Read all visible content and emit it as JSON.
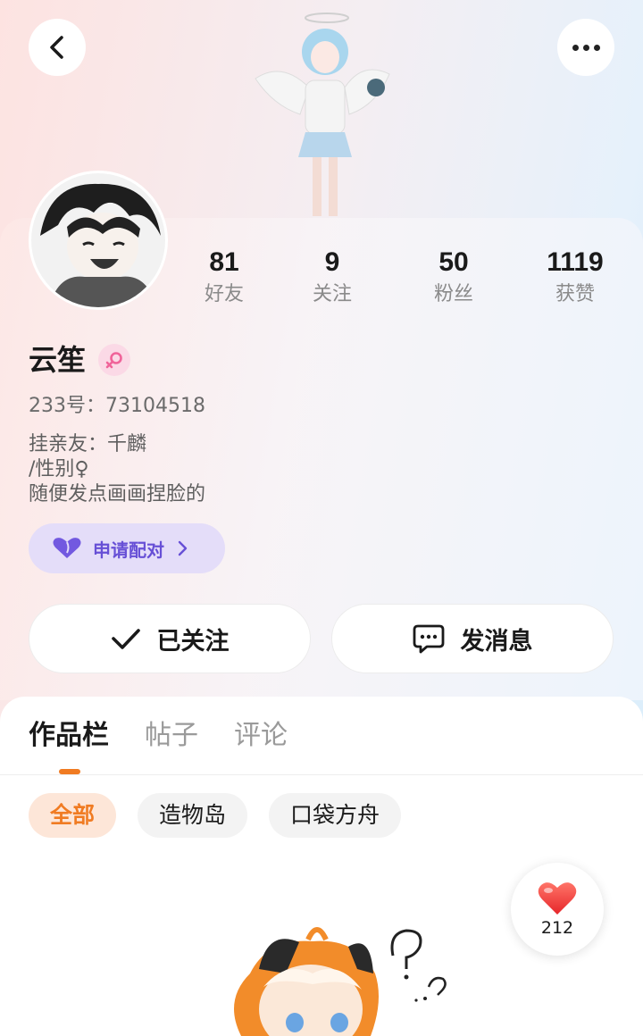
{
  "header": {
    "back_icon": "chevron-left-icon",
    "more_icon": "more-horizontal-icon"
  },
  "profile": {
    "stats": [
      {
        "value": "81",
        "label": "好友"
      },
      {
        "value": "9",
        "label": "关注"
      },
      {
        "value": "50",
        "label": "粉丝"
      },
      {
        "value": "1119",
        "label": "获赞"
      }
    ],
    "name": "云笙",
    "gender_icon": "female-icon",
    "uid": "233号：73104518",
    "bio_lines": [
      "挂亲友：千麟",
      "/性别♀",
      "随便发点画画捏脸的"
    ],
    "pair_button": {
      "label": "申请配对",
      "icon": "heart-icon"
    }
  },
  "actions": {
    "follow": {
      "label": "已关注",
      "icon": "check-icon"
    },
    "message": {
      "label": "发消息",
      "icon": "chat-bubble-icon"
    }
  },
  "tabs": [
    {
      "label": "作品栏",
      "active": true
    },
    {
      "label": "帖子",
      "active": false
    },
    {
      "label": "评论",
      "active": false
    }
  ],
  "filters": [
    {
      "label": "全部",
      "active": true
    },
    {
      "label": "造物岛",
      "active": false
    },
    {
      "label": "口袋方舟",
      "active": false
    }
  ],
  "like_button": {
    "count": "212",
    "icon": "heart-filled-icon"
  },
  "colors": {
    "accent": "#f07b22",
    "pair_purple": "#6750d6",
    "like_red": "#f03c3c"
  }
}
